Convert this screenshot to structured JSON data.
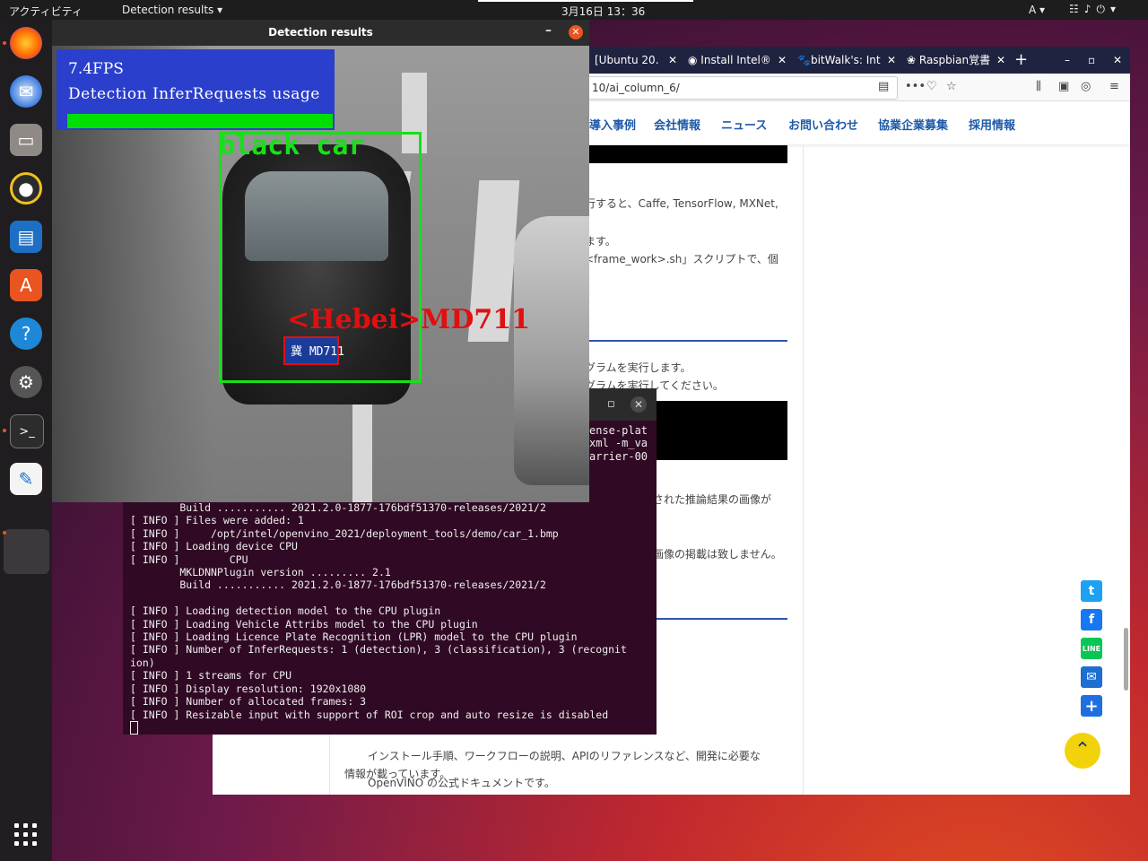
{
  "topbar": {
    "activities": "アクティビティ",
    "app_menu": "Detection results ▾",
    "clock": "3月16日  13：36",
    "ime": "A ▾"
  },
  "browser": {
    "tabs": [
      {
        "label": "[Ubuntu 20.",
        "icon": "doc-icon"
      },
      {
        "label": "Install Intel®",
        "icon": "circle-icon"
      },
      {
        "label": "bitWalk's: Int",
        "icon": "paw-icon"
      },
      {
        "label": "Raspbian覚書",
        "icon": "raspberry-icon"
      }
    ],
    "url": "10/ai_column_6/",
    "site_nav": [
      "導入事例",
      "会社情報",
      "ニュース",
      "お問い合わせ",
      "協業企業募集",
      "採用情報"
    ],
    "paragraphs": [
      "行すると、Caffe, TensorFlow, MXNet,",
      "ます。",
      "<frame_work>.sh」スクリプトで、個",
      "グラムを実行します。",
      "グラムを実行してください。",
      "された推論結果の画像が",
      "画像の掲載は致しません。",
      "OpenVINO の公式ドキュメントです。",
      "インストール手順、ワークフローの説明、APIのリファレンスなど、開発に必要な",
      "情報が載っています。"
    ],
    "share_icons": [
      "twitter-icon",
      "facebook-icon",
      "line-icon",
      "mail-icon",
      "plus-icon"
    ],
    "colors": {
      "accent": "#1e5aa8",
      "tabbar": "#202340",
      "totop": "#f2d20a"
    }
  },
  "terminal": {
    "fragments": [
      "ense-plat",
      "xml -m_va",
      "arrier-00"
    ],
    "lines": [
      "        Build ........... 2021.2.0-1877-176bdf51370-releases/2021/2",
      "[ INFO ] Files were added: 1",
      "[ INFO ]     /opt/intel/openvino_2021/deployment_tools/demo/car_1.bmp",
      "[ INFO ] Loading device CPU",
      "[ INFO ]        CPU",
      "        MKLDNNPlugin version ......... 2.1",
      "        Build ........... 2021.2.0-1877-176bdf51370-releases/2021/2",
      "",
      "[ INFO ] Loading detection model to the CPU plugin",
      "[ INFO ] Loading Vehicle Attribs model to the CPU plugin",
      "[ INFO ] Loading Licence Plate Recognition (LPR) model to the CPU plugin",
      "[ INFO ] Number of InferRequests: 1 (detection), 3 (classification), 3 (recognit",
      "ion)",
      "[ INFO ] 1 streams for CPU",
      "[ INFO ] Display resolution: 1920x1080",
      "[ INFO ] Number of allocated frames: 3",
      "[ INFO ] Resizable input with support of ROI crop and auto resize is disabled"
    ]
  },
  "detection_window": {
    "title": "Detection results",
    "fps": "7.4FPS",
    "usage_label": "Detection InferRequests usage",
    "usage_fraction": 1.0,
    "vehicle_label": "black car",
    "plate_label": "<Hebei>MD711",
    "plate_text": "冀 MD711",
    "colors": {
      "vehicle_box": "#18e018",
      "plate_box": "#e01010",
      "info_bg": "#2a3fcc"
    }
  },
  "dock": {
    "apps": [
      "firefox-icon",
      "thunderbird-icon",
      "files-icon",
      "rhythmbox-icon",
      "writer-icon",
      "software-icon",
      "help-icon",
      "settings-icon",
      "terminal-icon",
      "text-editor-icon"
    ]
  }
}
